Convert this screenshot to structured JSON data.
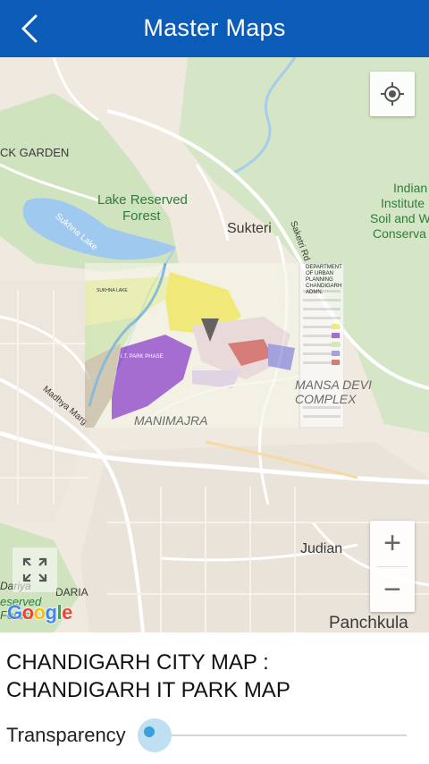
{
  "appbar": {
    "title": "Master Maps",
    "back_icon": "chevron-left-icon"
  },
  "map": {
    "place_labels": {
      "rock_garden": "CK GARDEN",
      "lake_reserved_forest_1": "Lake Reserved",
      "lake_reserved_forest_2": "Forest",
      "sukhna_lake": "Sukhna Lake",
      "sukteri": "Sukteri",
      "saketri_rd": "Saketri Rd",
      "indian_institute_1": "Indian",
      "indian_institute_2": "Institute",
      "indian_institute_3": "Soil and W",
      "indian_institute_4": "Conserva",
      "mansa_devi_1": "MANSA DEVI",
      "mansa_devi_2": "COMPLEX",
      "manimajra": "MANIMAJRA",
      "madhya_marg": "Madhya Marg",
      "judian": "Judian",
      "panchkula": "Panchkula",
      "daria_1": "Dariya",
      "daria_2": "DARIA",
      "reserved_forest_1": "eserved",
      "reserved_forest_2": "Forest"
    },
    "overlay": {
      "legend_title": "DEPARTMENT OF URBAN PLANNING CHANDIGARH ADMN.",
      "sukhna_lake": "SUKHNA LAKE",
      "it_park_label": "I.T. PARK PHASE",
      "manimajra": "MANIMAJRA"
    },
    "attribution": "Google",
    "buttons": {
      "locate_icon": "crosshair-location-icon",
      "fullscreen_icon": "fullscreen-icon",
      "zoom_in": "+",
      "zoom_out": "−"
    }
  },
  "info": {
    "title_line1": "CHANDIGARH CITY MAP :",
    "title_line2": "CHANDIGARH IT PARK MAP",
    "transparency_label": "Transparency",
    "transparency_value": 0.0
  },
  "colors": {
    "appbar": "#0a5cb8",
    "slider_accent": "#3aa0db"
  }
}
